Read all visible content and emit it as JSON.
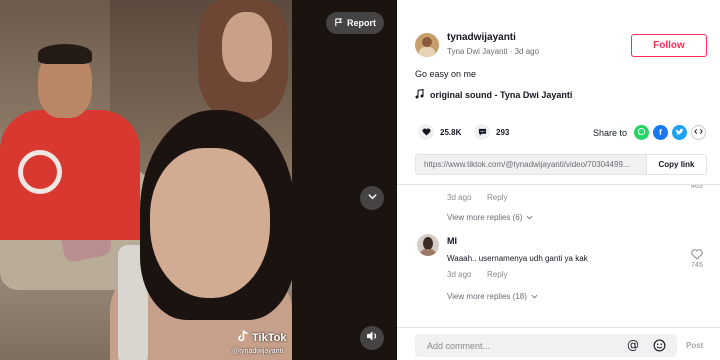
{
  "video": {
    "report_label": "Report",
    "watermark_brand": "TikTok",
    "watermark_user": "@tynadwijayanti"
  },
  "author": {
    "username": "tynadwijayanti",
    "display_name": "Tyna Dwi Jayanti",
    "separator": " · ",
    "posted": "3d ago",
    "follow_label": "Follow"
  },
  "post": {
    "caption": "Go easy on me",
    "sound": "original sound - Tyna Dwi Jayanti"
  },
  "stats": {
    "likes": "25.8K",
    "comments": "293"
  },
  "share": {
    "label": "Share to",
    "targets": [
      "whatsapp",
      "facebook",
      "twitter",
      "embed"
    ]
  },
  "link": {
    "url": "https://www.tiktok.com/@tynadwijayanti/video/70304499...",
    "copy_label": "Copy link"
  },
  "comments": {
    "prev": {
      "likes": "463",
      "time": "3d ago",
      "reply_label": "Reply",
      "view_more": "View more replies (6)"
    },
    "items": [
      {
        "name": "MI",
        "text": "Waaah.. usernamenya udh ganti ya kak",
        "time": "3d ago",
        "reply_label": "Reply",
        "likes": "745",
        "view_more": "View more replies (18)"
      }
    ]
  },
  "composer": {
    "placeholder": "Add comment...",
    "post_label": "Post"
  },
  "colors": {
    "accent": "#fe2c55",
    "whatsapp": "#25d366",
    "facebook": "#1877f2",
    "twitter": "#1da1f2",
    "embed": "#161823"
  }
}
